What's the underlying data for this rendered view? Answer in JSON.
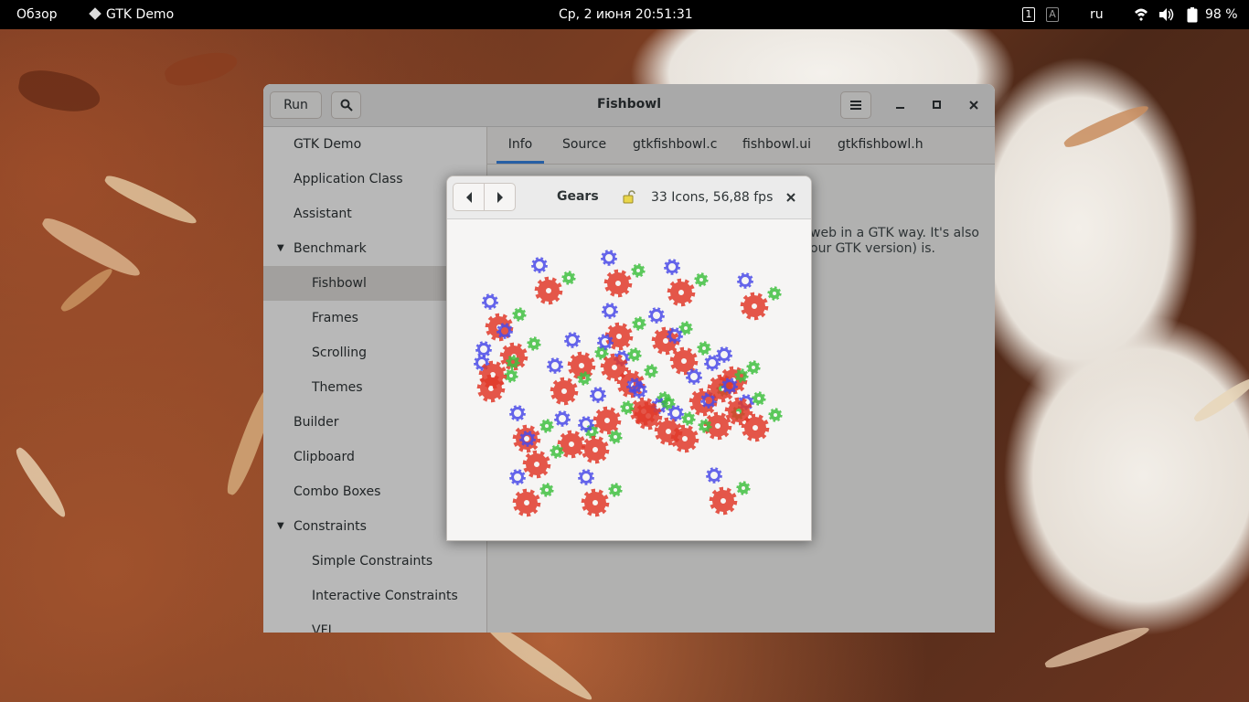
{
  "topbar": {
    "activities": "Обзор",
    "app_name": "GTK Demo",
    "clock": "Ср, 2 июня  20:51:31",
    "workspace_1": "1",
    "input_indicator": "A",
    "keyboard_layout": "ru",
    "battery": "98 %"
  },
  "window": {
    "title": "Fishbowl",
    "run_label": "Run"
  },
  "sidebar": {
    "items": [
      {
        "label": "GTK Demo"
      },
      {
        "label": "Application Class"
      },
      {
        "label": "Assistant"
      },
      {
        "label": "Benchmark"
      },
      {
        "label": "Fishbowl"
      },
      {
        "label": "Frames"
      },
      {
        "label": "Scrolling"
      },
      {
        "label": "Themes"
      },
      {
        "label": "Builder"
      },
      {
        "label": "Clipboard"
      },
      {
        "label": "Combo Boxes"
      },
      {
        "label": "Constraints"
      },
      {
        "label": "Simple Constraints"
      },
      {
        "label": "Interactive Constraints"
      },
      {
        "label": "VFL"
      }
    ],
    "selected": "Fishbowl"
  },
  "tabs": [
    {
      "label": "Info"
    },
    {
      "label": "Source"
    },
    {
      "label": "gtkfishbowl.c"
    },
    {
      "label": "fishbowl.ui"
    },
    {
      "label": "gtkfishbowl.h"
    }
  ],
  "info": {
    "line1": "web in a GTK way. It's also",
    "line2": "our GTK version) is."
  },
  "gears_window": {
    "title": "Gears",
    "status": "33 Icons, 56,88 fps"
  },
  "colors": {
    "accent": "#3584e4",
    "gear_red": "#e0392a",
    "gear_blue": "#4a4ae8",
    "gear_green": "#3fbf3f"
  }
}
